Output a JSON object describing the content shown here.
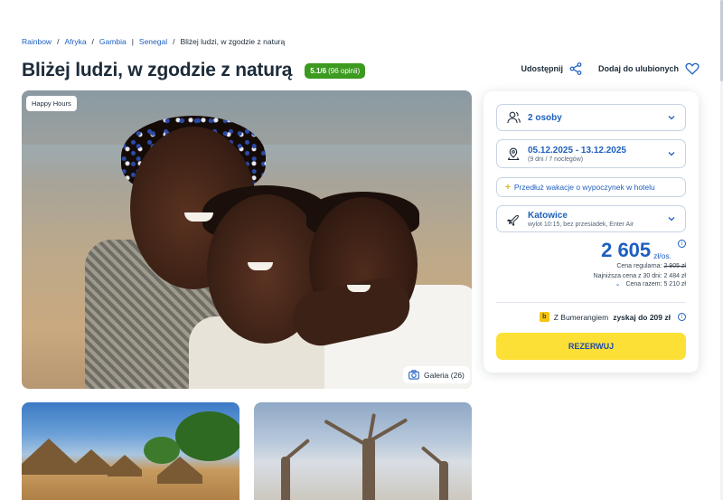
{
  "breadcrumb": {
    "items": [
      "Rainbow",
      "Afryka",
      "Gambia",
      "Senegal"
    ],
    "separators": [
      "/",
      "/",
      "|",
      "/"
    ],
    "current": "Bliżej ludzi, w zgodzie z naturą"
  },
  "header": {
    "title": "Bliżej ludzi, w zgodzie z naturą",
    "rating_score": "5.1/6",
    "rating_count": "(96 opinii)",
    "share_label": "Udostępnij",
    "favorite_label": "Dodaj do ulubionych"
  },
  "gallery": {
    "badge": "Happy Hours",
    "gallery_label": "Galeria (26)"
  },
  "booking": {
    "persons": "2 osoby",
    "dates": "05.12.2025 - 13.12.2025",
    "dates_sub": "(9 dni / 7 noclegów)",
    "extend": "Przedłuż wakacje o wypoczynek w hotelu",
    "departure_city": "Katowice",
    "departure_sub": "wylot 10:15, bez przesiadek, Enter Air",
    "price": "2 605",
    "price_unit": "zł/os.",
    "regular_label": "Cena regularna:",
    "regular_price": "2 905 zł",
    "lowest_label": "Najniższa cena z 30 dni:",
    "lowest_price": "2 484 zł",
    "total_label": "Cena razem:",
    "total_price": "5 210 zł",
    "bumerang_prefix": "Z Bumerangiem",
    "bumerang_gain": "zyskaj do 209 zł",
    "reserve_label": "REZERWUJ"
  },
  "colors": {
    "accent_blue": "#1e5fbf",
    "rating_green": "#3c9a1f",
    "cta_yellow": "#fde036"
  },
  "icons": [
    "share-icon",
    "heart-icon",
    "camera-icon",
    "persons-icon",
    "calendar-pin-icon",
    "plane-icon",
    "chevron-down-icon",
    "info-icon",
    "bumerang-icon"
  ]
}
